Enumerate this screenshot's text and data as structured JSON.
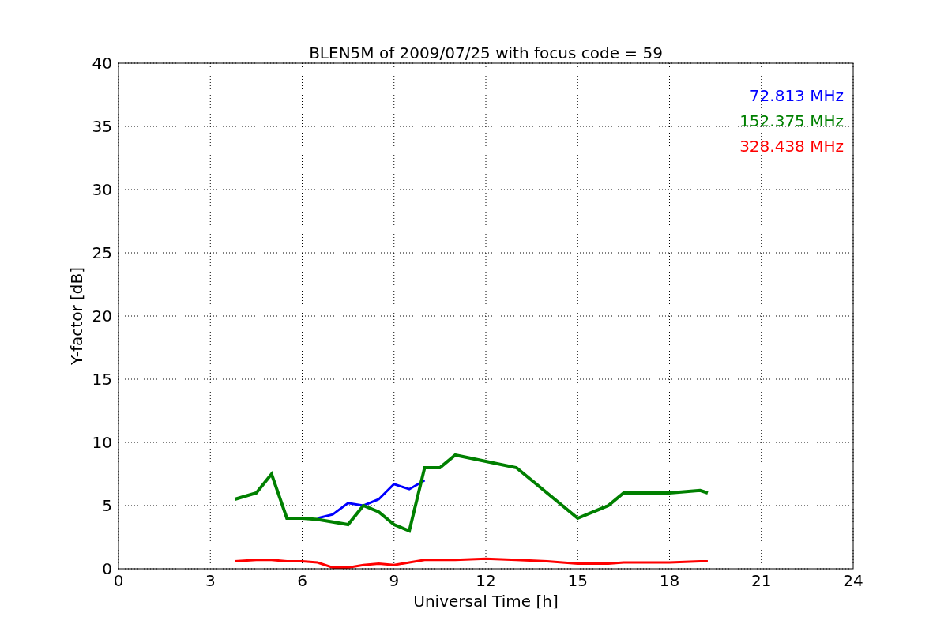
{
  "figure": {
    "chart_data": {
      "type": "line",
      "title": "BLEN5M of 2009/07/25 with focus code = 59",
      "xlabel": "Universal Time [h]",
      "ylabel": "Y-factor [dB]",
      "x": [
        3.8,
        4.5,
        5,
        5.5,
        6,
        6.5,
        7,
        7.5,
        8,
        8.5,
        9,
        9.5,
        10,
        10.5,
        11,
        12,
        13,
        14,
        15,
        16,
        16.5,
        17,
        18,
        19,
        19.25
      ],
      "series": [
        {
          "name": "72.813 MHz",
          "color": "#0000ff",
          "values": [
            null,
            null,
            null,
            null,
            null,
            4,
            4.3,
            5.2,
            5,
            5.5,
            6.7,
            6.3,
            7,
            null,
            null,
            null,
            null,
            null,
            null,
            null,
            null,
            null,
            null,
            null,
            null
          ]
        },
        {
          "name": "152.375 MHz",
          "color": "#008000",
          "values": [
            5.5,
            6,
            7.5,
            4,
            4,
            3.9,
            3.7,
            3.5,
            5,
            4.5,
            3.5,
            3,
            8,
            8,
            9,
            8.5,
            8,
            6,
            4,
            5,
            6,
            6,
            6,
            6.2,
            6
          ]
        },
        {
          "name": "328.438 MHz",
          "color": "#ff0000",
          "values": [
            0.6,
            0.7,
            0.7,
            0.6,
            0.6,
            0.5,
            0.1,
            0.1,
            0.3,
            0.4,
            0.3,
            0.5,
            0.7,
            0.7,
            0.7,
            0.8,
            0.7,
            0.6,
            0.4,
            0.4,
            0.5,
            0.5,
            0.5,
            0.6,
            0.6
          ]
        }
      ],
      "grid": true,
      "xlim": [
        0,
        24
      ],
      "ylim": [
        0,
        40
      ],
      "xticks": [
        0,
        3,
        6,
        9,
        12,
        15,
        18,
        21,
        24
      ],
      "yticks": [
        0,
        5,
        10,
        15,
        20,
        25,
        30,
        35,
        40
      ]
    }
  }
}
